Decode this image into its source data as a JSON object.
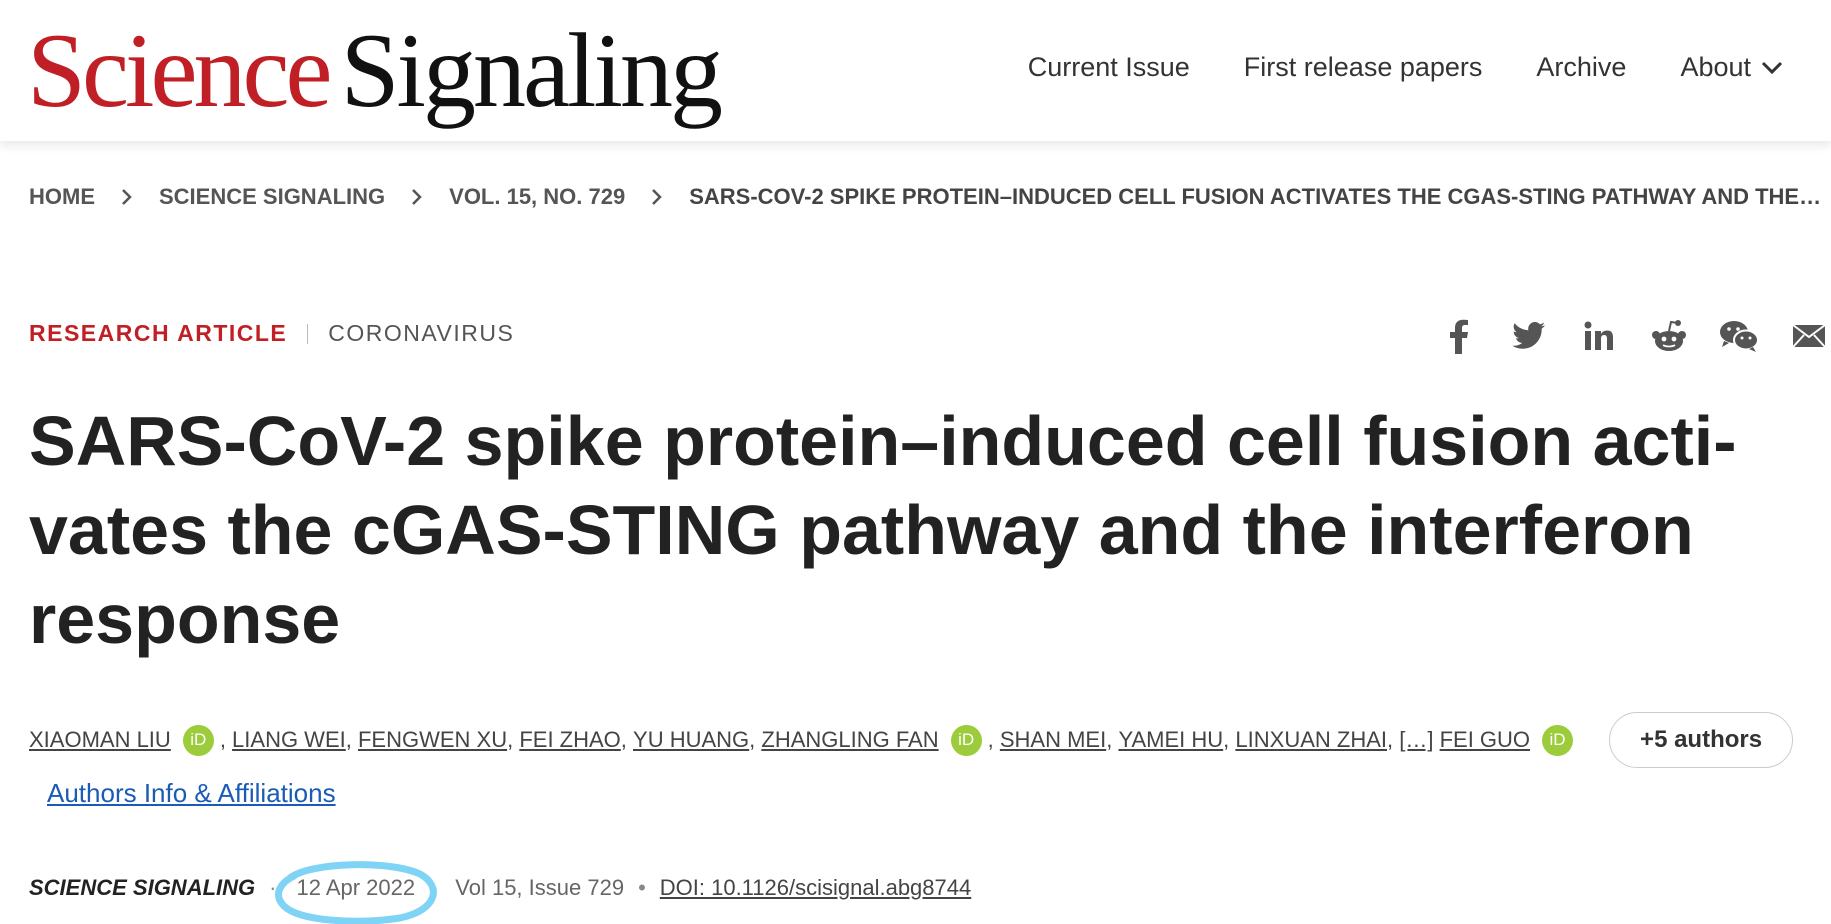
{
  "logo": {
    "word1": "Science",
    "word2": "Signaling"
  },
  "nav": {
    "current_issue": "Current Issue",
    "first_release": "First release papers",
    "archive": "Archive",
    "about": "About"
  },
  "breadcrumb": {
    "home": "HOME",
    "journal": "SCIENCE SIGNALING",
    "issue": "VOL. 15, NO. 729",
    "current": "SARS-COV-2 SPIKE PROTEIN–INDUCED CELL FUSION ACTIVATES THE CGAS-STING PATHWAY AND THE…"
  },
  "tags": {
    "type": "RESEARCH ARTICLE",
    "topic": "CORONAVIRUS"
  },
  "share_icons": [
    "facebook-icon",
    "twitter-icon",
    "linkedin-icon",
    "reddit-icon",
    "wechat-icon",
    "email-icon"
  ],
  "article": {
    "title_line1": "SARS-CoV-2 spike protein–induced cell fusion acti-",
    "title_line2": "vates the cGAS-STING pathway and the interferon",
    "title_line3": "response"
  },
  "authors": {
    "names": [
      "XIAOMAN LIU",
      "LIANG WEI",
      "FENGWEN XU",
      "FEI ZHAO",
      "YU HUANG",
      "ZHANGLING FAN",
      "SHAN MEI",
      "YAMEI HU",
      "LINXUAN ZHAI",
      "FEI GUO"
    ],
    "orcid_label": "iD",
    "ellipsis": "[…]",
    "more_button": "+5 authors",
    "affiliations_link": "Authors Info & Affiliations"
  },
  "meta": {
    "journal": "SCIENCE SIGNALING",
    "date": "12 Apr 2022",
    "volume": "Vol 15, Issue 729",
    "doi": "DOI: 10.1126/scisignal.abg8744"
  },
  "colors": {
    "brand_red": "#c02025",
    "orcid_green": "#9ccc3b",
    "link_blue": "#1a5bb5",
    "highlight_circle": "#7fd4f5"
  }
}
